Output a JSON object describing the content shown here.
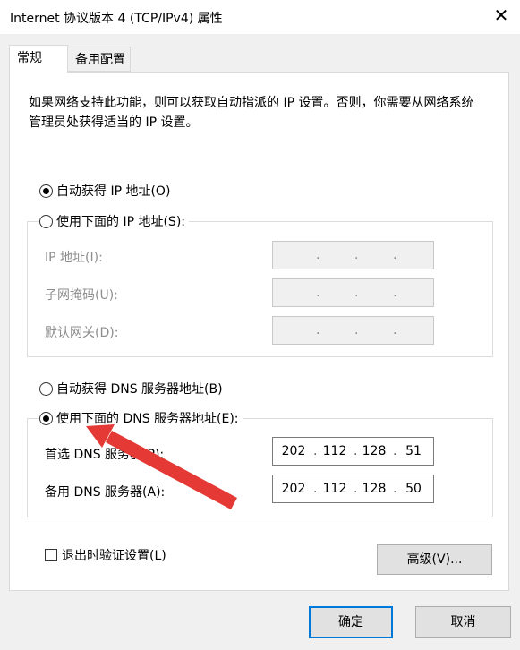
{
  "window": {
    "title": "Internet 协议版本 4 (TCP/IPv4) 属性",
    "close_glyph": "✕"
  },
  "tabs": [
    {
      "label": "常规",
      "active": true
    },
    {
      "label": "备用配置",
      "active": false
    }
  ],
  "description": "如果网络支持此功能，则可以获取自动指派的 IP 设置。否则，你需要从网络系统管理员处获得适当的 IP 设置。",
  "ip_section": {
    "auto_label": "自动获得 IP 地址(O)",
    "auto_checked": true,
    "manual_label": "使用下面的 IP 地址(S):",
    "manual_checked": false,
    "fields": [
      {
        "label": "IP 地址(I):",
        "segments": [
          "",
          "",
          "",
          ""
        ]
      },
      {
        "label": "子网掩码(U):",
        "segments": [
          "",
          "",
          "",
          ""
        ]
      },
      {
        "label": "默认网关(D):",
        "segments": [
          "",
          "",
          "",
          ""
        ]
      }
    ]
  },
  "dns_section": {
    "auto_label": "自动获得 DNS 服务器地址(B)",
    "auto_checked": false,
    "manual_label": "使用下面的 DNS 服务器地址(E):",
    "manual_checked": true,
    "preferred": {
      "label": "首选 DNS 服务器(P):",
      "segments": [
        "202",
        "112",
        "128",
        "51"
      ]
    },
    "alternate": {
      "label": "备用 DNS 服务器(A):",
      "segments": [
        "202",
        "112",
        "128",
        "50"
      ]
    }
  },
  "validate_on_exit": {
    "label": "退出时验证设置(L)",
    "checked": false
  },
  "buttons": {
    "advanced": "高级(V)...",
    "ok": "确定",
    "cancel": "取消"
  },
  "colors": {
    "accent": "#0078d7",
    "annotation_arrow": "#e53935"
  }
}
